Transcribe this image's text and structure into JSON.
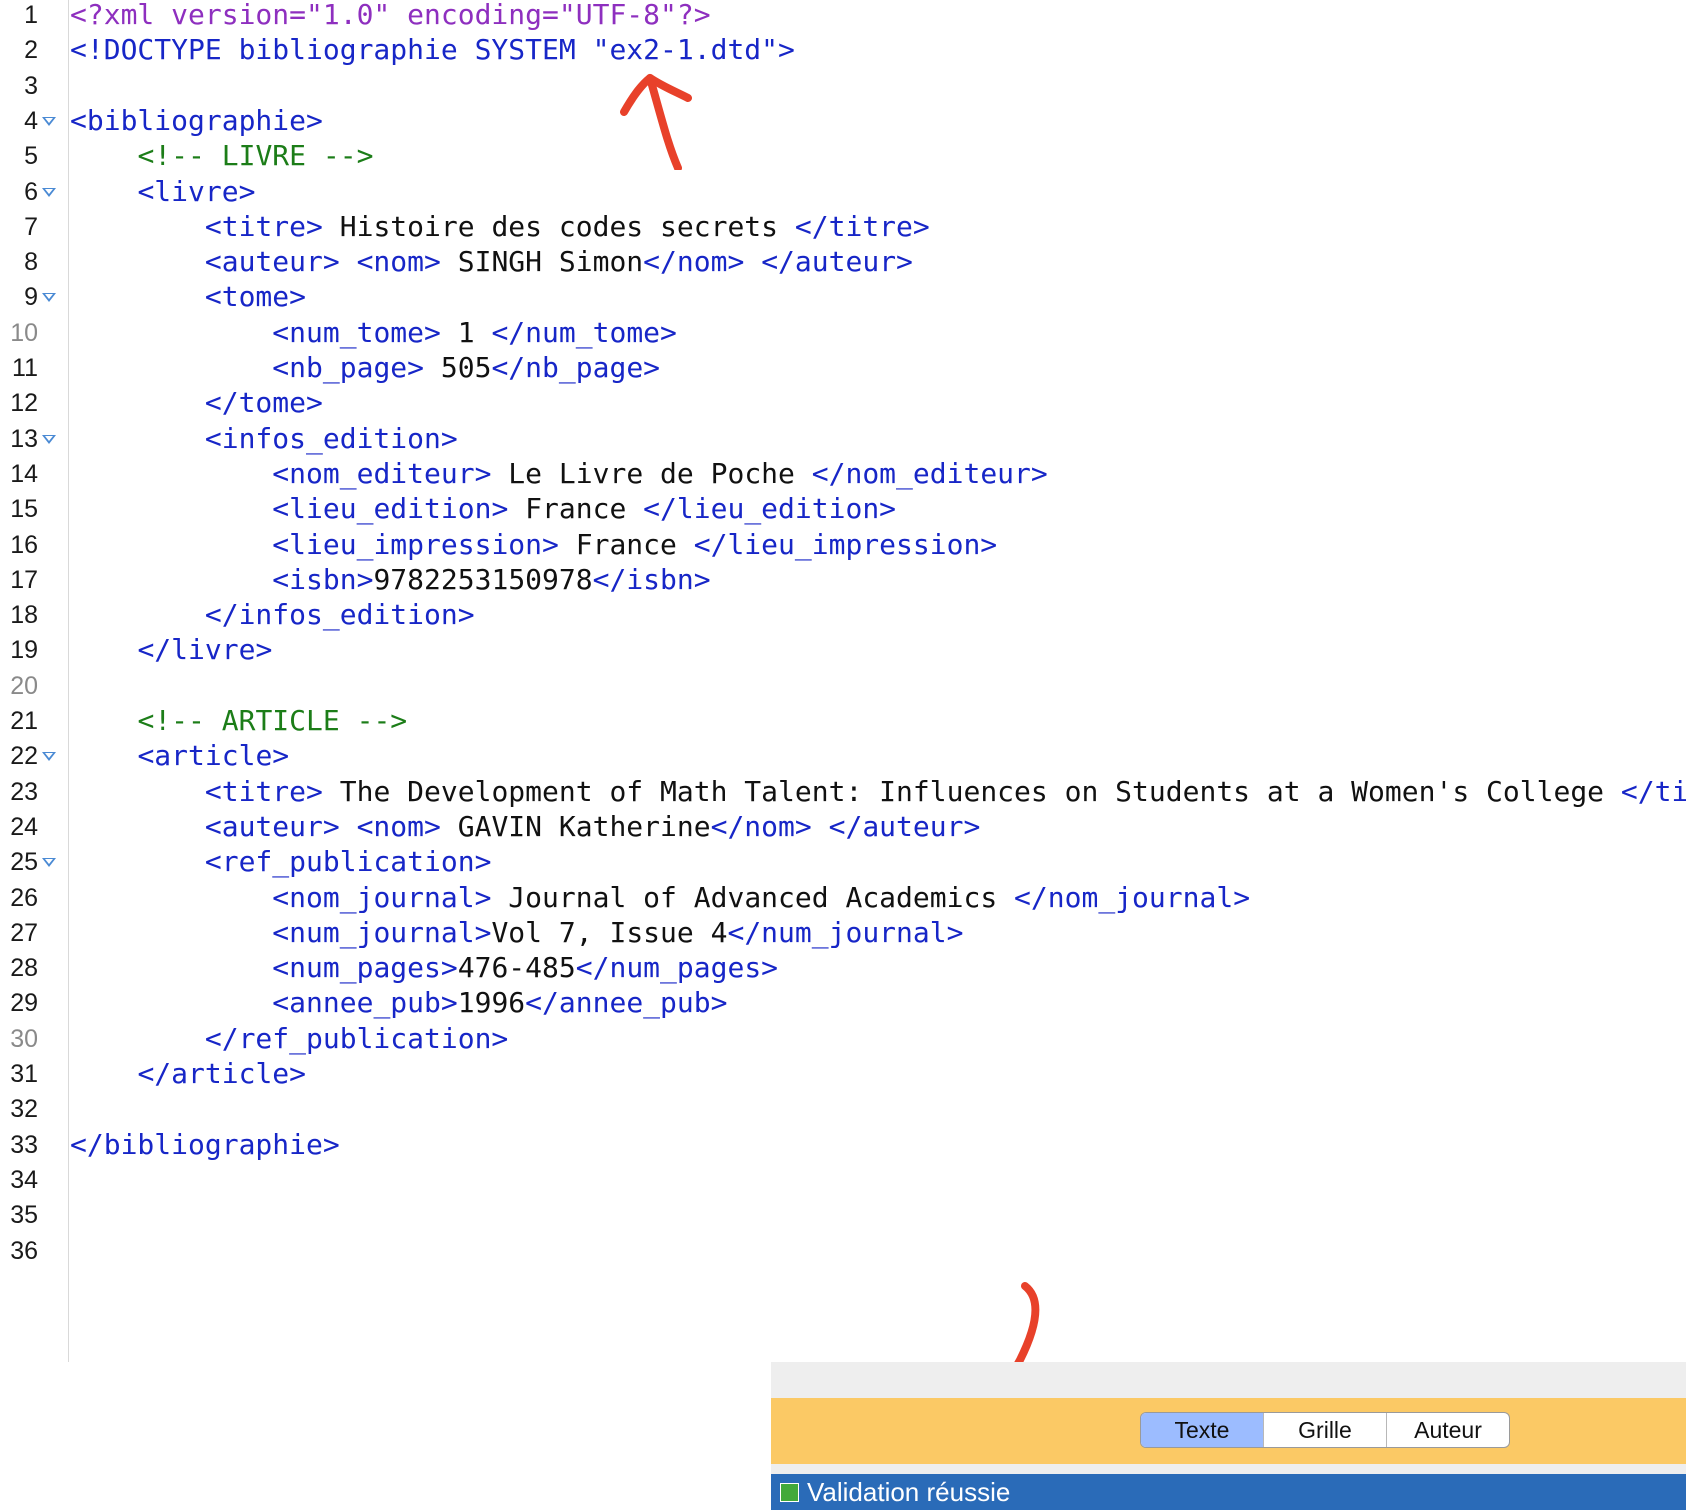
{
  "editor": {
    "lines": [
      {
        "n": "1",
        "tokens": [
          {
            "c": "pi",
            "t": "<?xml version=\"1.0\" encoding=\"UTF-8\"?>"
          }
        ]
      },
      {
        "n": "2",
        "tokens": [
          {
            "c": "doc",
            "t": "<!DOCTYPE bibliographie SYSTEM \"ex2-1.dtd\">"
          }
        ]
      },
      {
        "n": "3",
        "tokens": []
      },
      {
        "n": "4",
        "fold": true,
        "tokens": [
          {
            "c": "tag",
            "t": "<bibliographie>"
          }
        ]
      },
      {
        "n": "5",
        "tokens": [
          {
            "c": "txt",
            "t": "    "
          },
          {
            "c": "cmt",
            "t": "<!-- LIVRE -->"
          }
        ]
      },
      {
        "n": "6",
        "fold": true,
        "tokens": [
          {
            "c": "txt",
            "t": "    "
          },
          {
            "c": "tag",
            "t": "<livre>"
          }
        ]
      },
      {
        "n": "7",
        "tokens": [
          {
            "c": "txt",
            "t": "        "
          },
          {
            "c": "tag",
            "t": "<titre>"
          },
          {
            "c": "txt",
            "t": " Histoire des codes secrets "
          },
          {
            "c": "tag",
            "t": "</titre>"
          }
        ]
      },
      {
        "n": "8",
        "tokens": [
          {
            "c": "txt",
            "t": "        "
          },
          {
            "c": "tag",
            "t": "<auteur>"
          },
          {
            "c": "txt",
            "t": " "
          },
          {
            "c": "tag",
            "t": "<nom>"
          },
          {
            "c": "txt",
            "t": " SINGH Simon"
          },
          {
            "c": "tag",
            "t": "</nom>"
          },
          {
            "c": "txt",
            "t": " "
          },
          {
            "c": "tag",
            "t": "</auteur>"
          }
        ]
      },
      {
        "n": "9",
        "fold": true,
        "tokens": [
          {
            "c": "txt",
            "t": "        "
          },
          {
            "c": "tag",
            "t": "<tome>"
          }
        ]
      },
      {
        "n": "10",
        "dim": true,
        "tokens": [
          {
            "c": "txt",
            "t": "            "
          },
          {
            "c": "tag",
            "t": "<num_tome>"
          },
          {
            "c": "txt",
            "t": " 1 "
          },
          {
            "c": "tag",
            "t": "</num_tome>"
          }
        ]
      },
      {
        "n": "11",
        "tokens": [
          {
            "c": "txt",
            "t": "            "
          },
          {
            "c": "tag",
            "t": "<nb_page>"
          },
          {
            "c": "txt",
            "t": " 505"
          },
          {
            "c": "tag",
            "t": "</nb_page>"
          }
        ]
      },
      {
        "n": "12",
        "tokens": [
          {
            "c": "txt",
            "t": "        "
          },
          {
            "c": "tag",
            "t": "</tome>"
          }
        ]
      },
      {
        "n": "13",
        "fold": true,
        "tokens": [
          {
            "c": "txt",
            "t": "        "
          },
          {
            "c": "tag",
            "t": "<infos_edition>"
          }
        ]
      },
      {
        "n": "14",
        "tokens": [
          {
            "c": "txt",
            "t": "            "
          },
          {
            "c": "tag",
            "t": "<nom_editeur>"
          },
          {
            "c": "txt",
            "t": " Le Livre de Poche "
          },
          {
            "c": "tag",
            "t": "</nom_editeur>"
          }
        ]
      },
      {
        "n": "15",
        "tokens": [
          {
            "c": "txt",
            "t": "            "
          },
          {
            "c": "tag",
            "t": "<lieu_edition>"
          },
          {
            "c": "txt",
            "t": " France "
          },
          {
            "c": "tag",
            "t": "</lieu_edition>"
          }
        ]
      },
      {
        "n": "16",
        "tokens": [
          {
            "c": "txt",
            "t": "            "
          },
          {
            "c": "tag",
            "t": "<lieu_impression>"
          },
          {
            "c": "txt",
            "t": " France "
          },
          {
            "c": "tag",
            "t": "</lieu_impression>"
          }
        ]
      },
      {
        "n": "17",
        "tokens": [
          {
            "c": "txt",
            "t": "            "
          },
          {
            "c": "tag",
            "t": "<isbn>"
          },
          {
            "c": "txt",
            "t": "9782253150978"
          },
          {
            "c": "tag",
            "t": "</isbn>"
          }
        ]
      },
      {
        "n": "18",
        "tokens": [
          {
            "c": "txt",
            "t": "        "
          },
          {
            "c": "tag",
            "t": "</infos_edition>"
          }
        ]
      },
      {
        "n": "19",
        "tokens": [
          {
            "c": "txt",
            "t": "    "
          },
          {
            "c": "tag",
            "t": "</livre>"
          }
        ]
      },
      {
        "n": "20",
        "dim": true,
        "tokens": []
      },
      {
        "n": "21",
        "tokens": [
          {
            "c": "txt",
            "t": "    "
          },
          {
            "c": "cmt",
            "t": "<!-- ARTICLE -->"
          }
        ]
      },
      {
        "n": "22",
        "fold": true,
        "tokens": [
          {
            "c": "txt",
            "t": "    "
          },
          {
            "c": "tag",
            "t": "<article>"
          }
        ]
      },
      {
        "n": "23",
        "tokens": [
          {
            "c": "txt",
            "t": "        "
          },
          {
            "c": "tag",
            "t": "<titre>"
          },
          {
            "c": "txt",
            "t": " The Development of Math Talent: Influences on Students at a Women's College "
          },
          {
            "c": "tag",
            "t": "</titre>"
          }
        ]
      },
      {
        "n": "24",
        "tokens": [
          {
            "c": "txt",
            "t": "        "
          },
          {
            "c": "tag",
            "t": "<auteur>"
          },
          {
            "c": "txt",
            "t": " "
          },
          {
            "c": "tag",
            "t": "<nom>"
          },
          {
            "c": "txt",
            "t": " GAVIN Katherine"
          },
          {
            "c": "tag",
            "t": "</nom>"
          },
          {
            "c": "txt",
            "t": " "
          },
          {
            "c": "tag",
            "t": "</auteur>"
          }
        ]
      },
      {
        "n": "25",
        "fold": true,
        "tokens": [
          {
            "c": "txt",
            "t": "        "
          },
          {
            "c": "tag",
            "t": "<ref_publication>"
          }
        ]
      },
      {
        "n": "26",
        "tokens": [
          {
            "c": "txt",
            "t": "            "
          },
          {
            "c": "tag",
            "t": "<nom_journal>"
          },
          {
            "c": "txt",
            "t": " Journal of Advanced Academics "
          },
          {
            "c": "tag",
            "t": "</nom_journal>"
          }
        ]
      },
      {
        "n": "27",
        "tokens": [
          {
            "c": "txt",
            "t": "            "
          },
          {
            "c": "tag",
            "t": "<num_journal>"
          },
          {
            "c": "txt",
            "t": "Vol 7, Issue 4"
          },
          {
            "c": "tag",
            "t": "</num_journal>"
          }
        ]
      },
      {
        "n": "28",
        "tokens": [
          {
            "c": "txt",
            "t": "            "
          },
          {
            "c": "tag",
            "t": "<num_pages>"
          },
          {
            "c": "txt",
            "t": "476-485"
          },
          {
            "c": "tag",
            "t": "</num_pages>"
          }
        ]
      },
      {
        "n": "29",
        "tokens": [
          {
            "c": "txt",
            "t": "            "
          },
          {
            "c": "tag",
            "t": "<annee_pub>"
          },
          {
            "c": "txt",
            "t": "1996"
          },
          {
            "c": "tag",
            "t": "</annee_pub>"
          }
        ]
      },
      {
        "n": "30",
        "dim": true,
        "tokens": [
          {
            "c": "txt",
            "t": "        "
          },
          {
            "c": "tag",
            "t": "</ref_publication>"
          }
        ]
      },
      {
        "n": "31",
        "tokens": [
          {
            "c": "txt",
            "t": "    "
          },
          {
            "c": "tag",
            "t": "</article>"
          }
        ]
      },
      {
        "n": "32",
        "tokens": []
      },
      {
        "n": "33",
        "tokens": [
          {
            "c": "tag",
            "t": "</bibliographie>"
          }
        ]
      },
      {
        "n": "34",
        "tokens": []
      },
      {
        "n": "35",
        "tokens": []
      },
      {
        "n": "36",
        "tokens": []
      }
    ]
  },
  "mode_bar": {
    "tabs": [
      {
        "label": "Texte",
        "active": true
      },
      {
        "label": "Grille",
        "active": false
      },
      {
        "label": "Auteur",
        "active": false
      }
    ]
  },
  "status": {
    "text": "Validation réussie",
    "indicator_color": "#42a93a"
  },
  "colors": {
    "processing_instruction": "#8e2fbf",
    "doctype": "#1726c7",
    "tag": "#1726c7",
    "comment": "#1c7d18",
    "text": "#111111",
    "annotation": "#e8412a",
    "mode_bar": "#fbc965",
    "status_bar": "#2a6bb8"
  }
}
